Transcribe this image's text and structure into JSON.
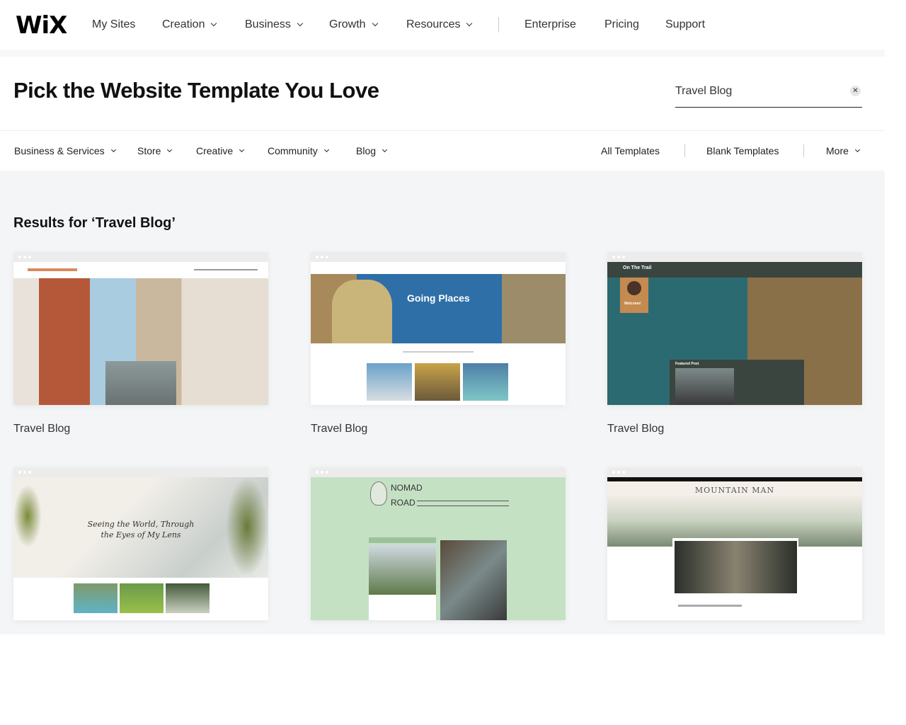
{
  "nav": {
    "logo": "WiX",
    "items": [
      {
        "label": "My Sites",
        "dropdown": false
      },
      {
        "label": "Creation",
        "dropdown": true
      },
      {
        "label": "Business",
        "dropdown": true
      },
      {
        "label": "Growth",
        "dropdown": true
      },
      {
        "label": "Resources",
        "dropdown": true
      }
    ],
    "right_items": [
      "Enterprise",
      "Pricing",
      "Support"
    ]
  },
  "header": {
    "title": "Pick the Website Template You Love",
    "search": {
      "value": "Travel Blog",
      "clear_icon": "close-icon"
    }
  },
  "filters": {
    "categories": [
      "Business & Services",
      "Store",
      "Creative",
      "Community",
      "Blog"
    ],
    "all_templates": "All Templates",
    "blank_templates": "Blank Templates",
    "more": "More"
  },
  "results": {
    "heading": "Results for ‘Travel Blog’",
    "templates": [
      {
        "name": "Travel Blog"
      },
      {
        "name": "Travel Blog",
        "hero_text": "Going Places"
      },
      {
        "name": "Travel Blog",
        "brand": "On The Trail",
        "welcome": "Welcome!",
        "featured": "Featured Post"
      },
      {
        "hero_line1": "Seeing the World, Through",
        "hero_line2": "the Eyes of My Lens"
      },
      {
        "brand_top": "NOMAD",
        "brand_bottom": "ROAD"
      },
      {
        "brand": "MOUNTAIN MAN"
      }
    ]
  },
  "colors": {
    "accent_trail": "#c58a4f",
    "nomad_bg": "#c5e1c4",
    "trail_bg": "#3a4540"
  }
}
